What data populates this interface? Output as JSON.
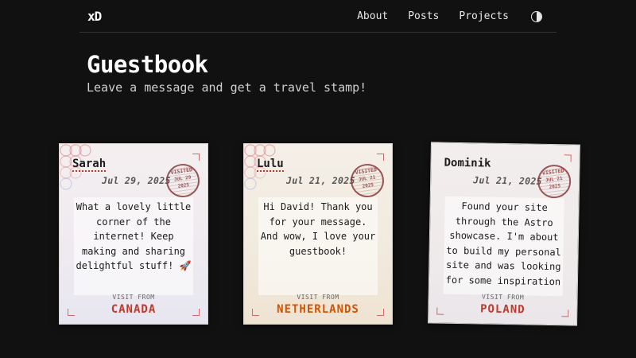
{
  "nav": {
    "logo": "xD",
    "links": [
      "About",
      "Posts",
      "Projects"
    ],
    "theme_icon": "contrast-icon"
  },
  "header": {
    "title": "Guestbook",
    "subtitle": "Leave a message and get a travel stamp!"
  },
  "entries": [
    {
      "name": "Sarah",
      "date": "Jul 29, 2025",
      "stamp": {
        "top": "VISITED",
        "mid": "JUL 29",
        "bot": "2025"
      },
      "message": "What a lovely little corner of the internet! Keep making and sharing delightful stuff! 🚀",
      "visit_from": "VISIT FROM",
      "country": "CANADA"
    },
    {
      "name": "Lulu",
      "date": "Jul 21, 2025",
      "stamp": {
        "top": "VISITED",
        "mid": "JUL 21",
        "bot": "2025"
      },
      "message": "Hi David! Thank you for your message. And wow, I love your guestbook!",
      "visit_from": "VISIT FROM",
      "country": "NETHERLANDS"
    },
    {
      "name": "Dominik",
      "date": "Jul 21, 2025",
      "stamp": {
        "top": "VISITED",
        "mid": "JUL 21",
        "bot": "2025"
      },
      "message": "Found your site through the Astro showcase. I'm about to build my personal site and was looking for some inspiration",
      "visit_from": "VISIT FROM",
      "country": "POLAND"
    }
  ]
}
